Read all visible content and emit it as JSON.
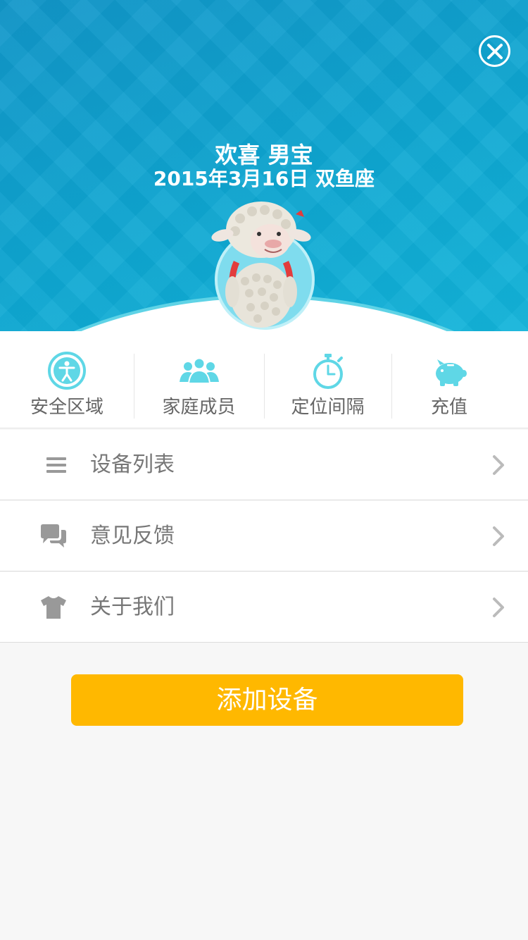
{
  "header": {
    "greeting": "欢喜 男宝",
    "birth_info": "2015年3月16日 双鱼座",
    "avatar_name": "sheep-avatar"
  },
  "quick_actions": [
    {
      "label": "安全区域",
      "icon": "accessibility-icon"
    },
    {
      "label": "家庭成员",
      "icon": "family-icon"
    },
    {
      "label": "定位间隔",
      "icon": "stopwatch-icon"
    },
    {
      "label": "充值",
      "icon": "piggy-bank-icon"
    }
  ],
  "menu": [
    {
      "label": "设备列表",
      "icon": "list-icon"
    },
    {
      "label": "意见反馈",
      "icon": "chat-icon"
    },
    {
      "label": "关于我们",
      "icon": "tshirt-icon"
    }
  ],
  "add_device_label": "添加设备",
  "colors": {
    "header_blue": "#0ea7d2",
    "accent_cyan": "#5fd3e6",
    "button_yellow": "#ffb800",
    "text_gray": "#777777"
  }
}
